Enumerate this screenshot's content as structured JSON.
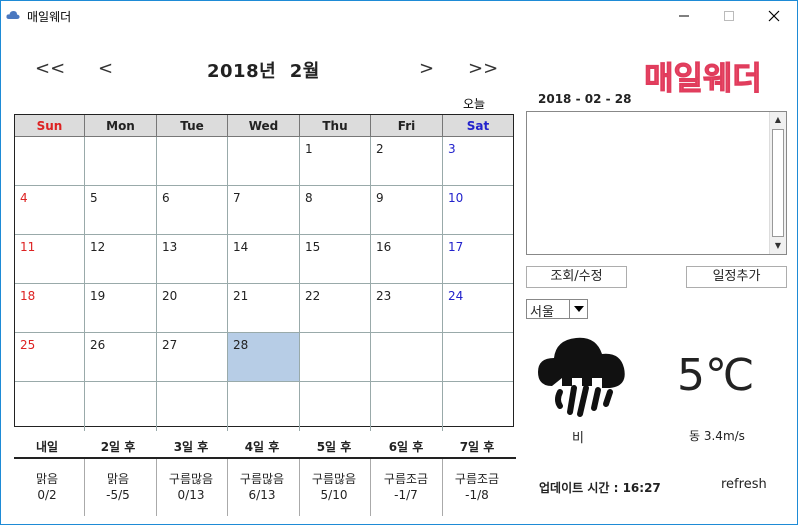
{
  "window": {
    "title": "매일웨더"
  },
  "nav": {
    "prev_year": "<<",
    "prev_month": "<",
    "next_month": ">",
    "next_year": ">>",
    "title": "2018년  2월",
    "today": "오늘"
  },
  "calendar": {
    "weekdays": [
      "Sun",
      "Mon",
      "Tue",
      "Wed",
      "Thu",
      "Fri",
      "Sat"
    ],
    "weeks": [
      [
        "",
        "",
        "",
        "",
        "1",
        "2",
        "3"
      ],
      [
        "4",
        "5",
        "6",
        "7",
        "8",
        "9",
        "10"
      ],
      [
        "11",
        "12",
        "13",
        "14",
        "15",
        "16",
        "17"
      ],
      [
        "18",
        "19",
        "20",
        "21",
        "22",
        "23",
        "24"
      ],
      [
        "25",
        "26",
        "27",
        "28",
        "",
        "",
        ""
      ],
      [
        "",
        "",
        "",
        "",
        "",
        "",
        ""
      ]
    ],
    "selected_day": "28"
  },
  "forecast": {
    "days": [
      {
        "label": "내일",
        "condition": "맑음",
        "temps": "0/2"
      },
      {
        "label": "2일 후",
        "condition": "맑음",
        "temps": "-5/5"
      },
      {
        "label": "3일 후",
        "condition": "구름많음",
        "temps": "0/13"
      },
      {
        "label": "4일 후",
        "condition": "구름많음",
        "temps": "6/13"
      },
      {
        "label": "5일 후",
        "condition": "구름많음",
        "temps": "5/10"
      },
      {
        "label": "6일 후",
        "condition": "구름조금",
        "temps": "-1/7"
      },
      {
        "label": "7일 후",
        "condition": "구름조금",
        "temps": "-1/8"
      }
    ]
  },
  "right": {
    "logo": "매일웨더",
    "selected_date": "2018 - 02 - 28",
    "memo_text": "",
    "view_edit_label": "조회/수정",
    "add_schedule_label": "일정추가",
    "city": "서울",
    "weather_label": "비",
    "weather_icon": "rain-cloud-icon",
    "temperature": "5℃",
    "wind": "동 3.4m/s",
    "updated": "업데이트 시간 : 16:27",
    "refresh_label": "refresh"
  },
  "colors": {
    "sunday": "#dd2222",
    "saturday": "#2222cc",
    "selected": "#b7cde6",
    "logo": "#f0506e"
  }
}
